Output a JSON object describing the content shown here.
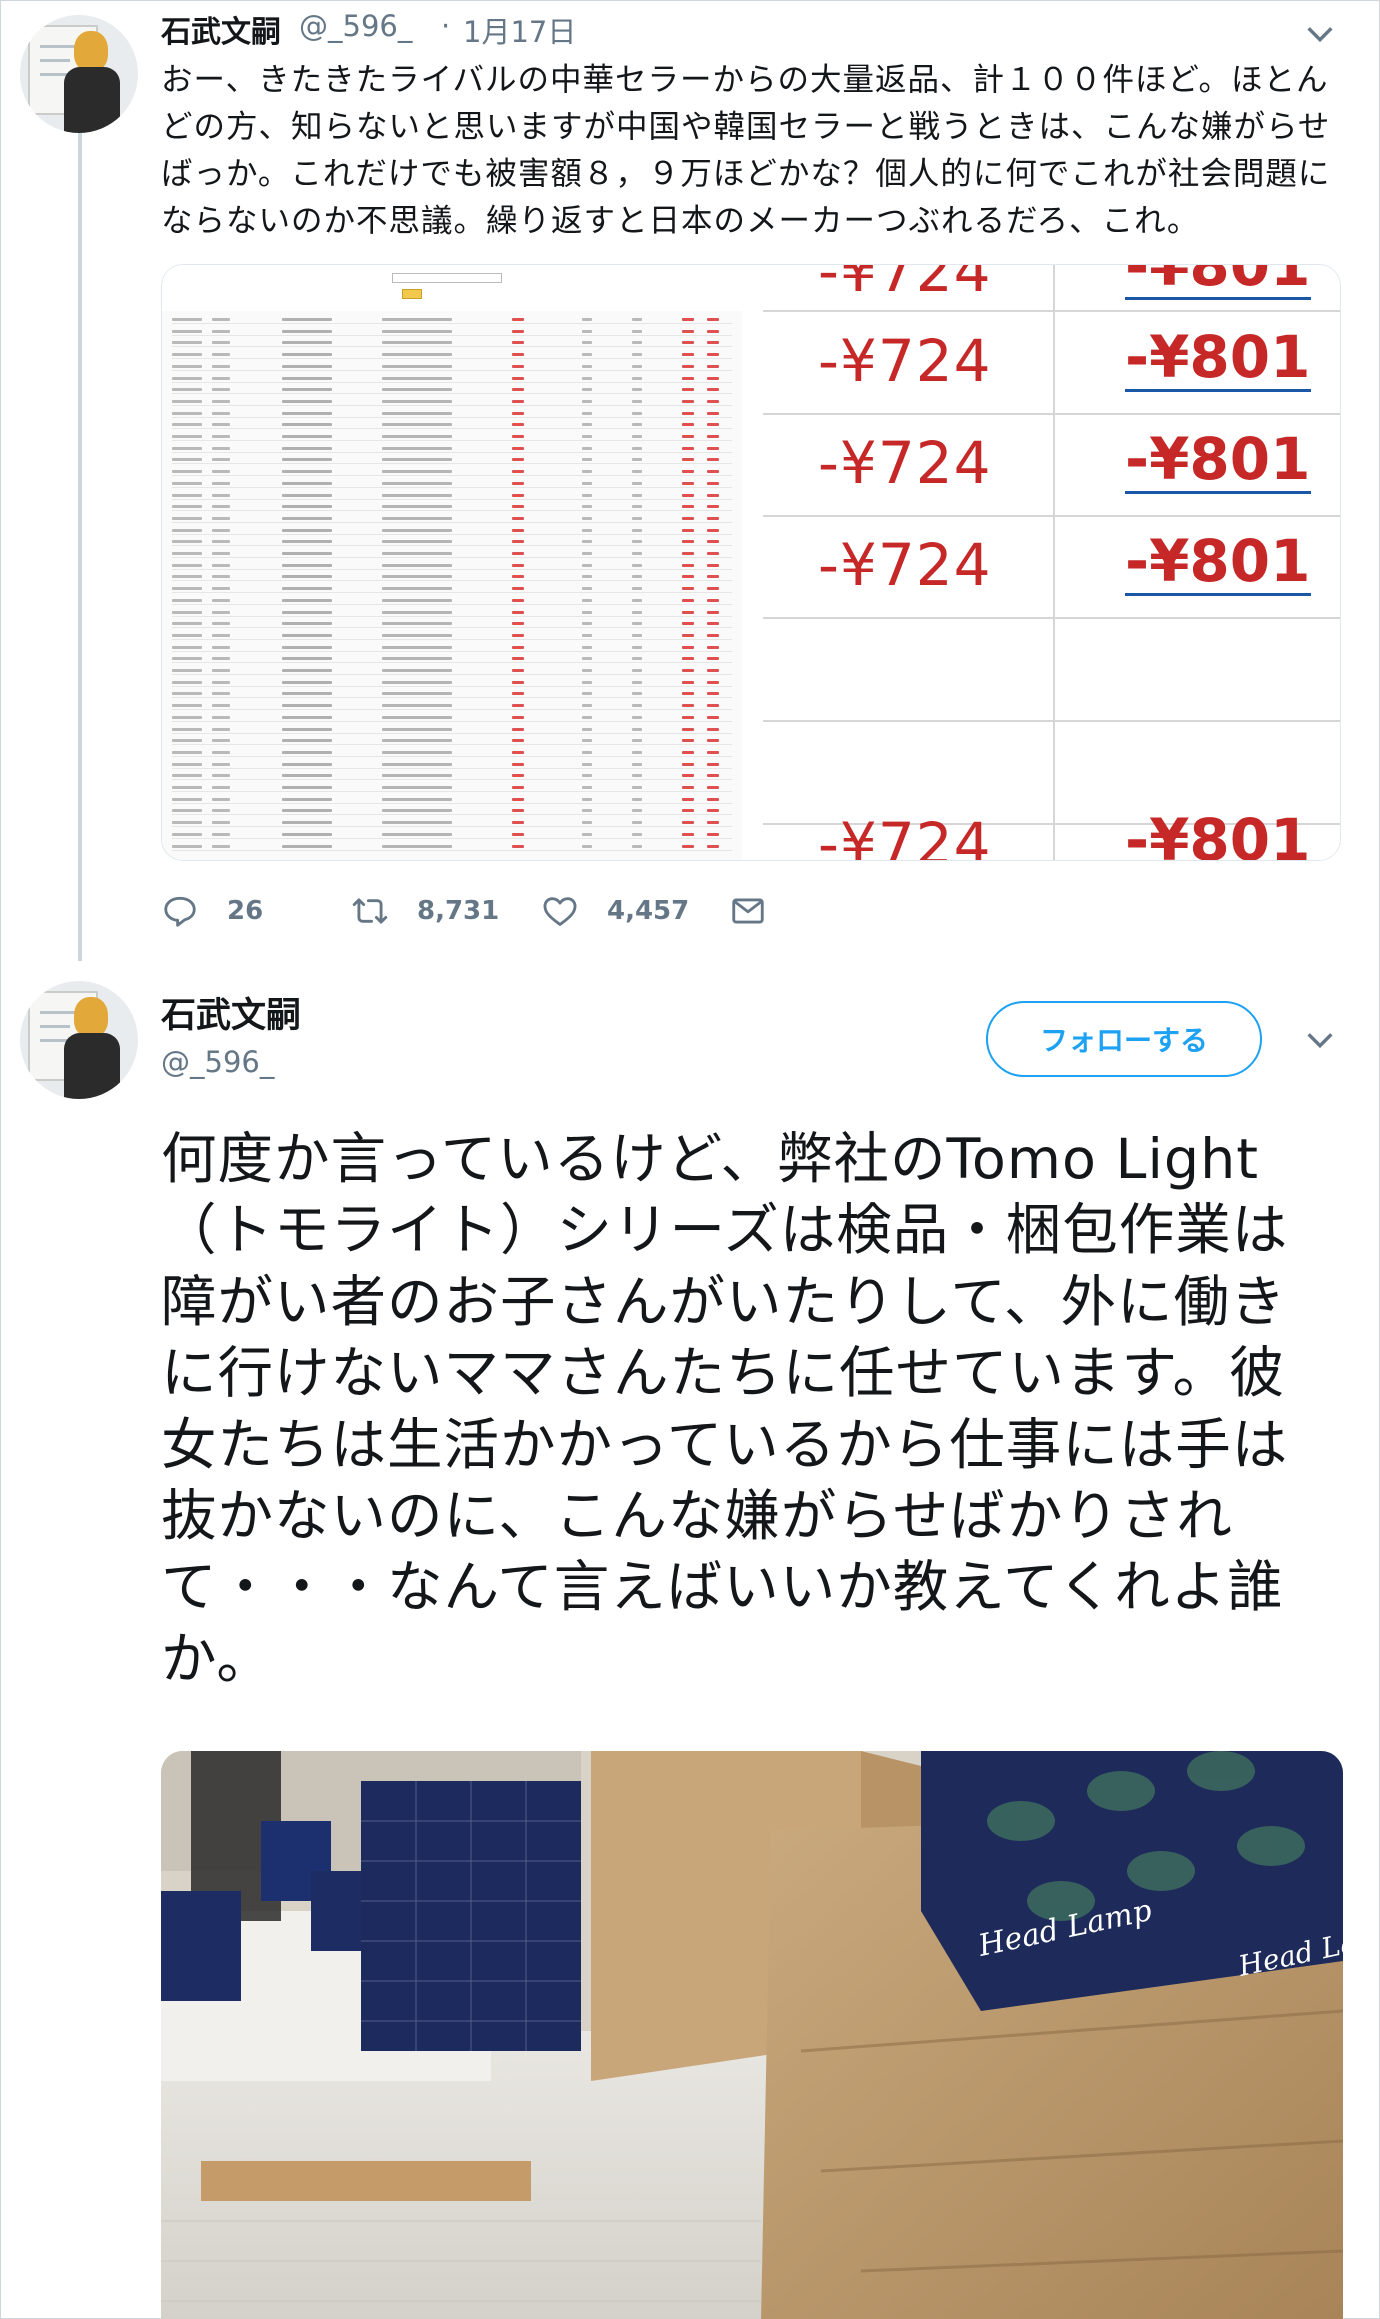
{
  "tweet1": {
    "name": "石武文嗣",
    "handle": "@_596_",
    "separator": "·",
    "date": "1月17日",
    "text": "おー、きたきたライバルの中華セラーからの大量返品、計１００件ほど。ほとんどの方、知らないと思いますが中国や韓国セラーと戦うときは、こんな嫌がらせばっか。これだけでも被害額８，９万ほどかな？個人的に何でこれが社会問題にならないのか不思議。繰り返すと日本のメーカーつぶれるだろ、これ。",
    "zoom_values": [
      "-¥724",
      "-¥801"
    ],
    "actions": {
      "replies": "26",
      "retweets": "8,731",
      "likes": "4,457"
    }
  },
  "tweet2": {
    "name": "石武文嗣",
    "handle": "@_596_",
    "follow_label": "フォローする",
    "text": "何度か言っているけど、弊社のTomo Light（トモライト）シリーズは検品・梱包作業は障がい者のお子さんがいたりして、外に働きに行けないママさんたちに任せています。彼女たちは生活かかっているから仕事には手は抜かないのに、こんな嫌がらせばかりされて・・・なんて言えばいいか教えてくれよ誰か。",
    "photo_box_label": "Head Lamp"
  },
  "colors": {
    "text": "#14171a",
    "secondary": "#657786",
    "accent": "#1da1f2",
    "price_red": "#c62828",
    "link_blue": "#1b57a8"
  }
}
